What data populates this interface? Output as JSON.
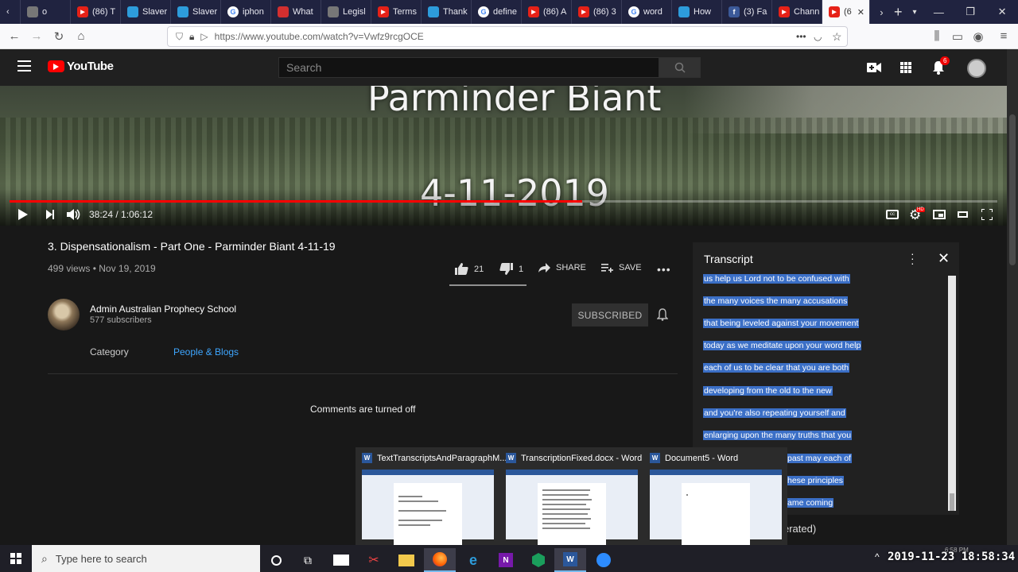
{
  "browser": {
    "tabs": [
      {
        "label": "",
        "icon": "chevron-left-icon",
        "type": "nav"
      },
      {
        "label": "o",
        "icon": "generic-favicon-icon",
        "color": "#777777"
      },
      {
        "label": "(86) T",
        "icon": "youtube-favicon-icon",
        "color": "#e62117"
      },
      {
        "label": "Slaver",
        "icon": "blue-favicon-icon",
        "color": "#2d9cdb"
      },
      {
        "label": "Slaver",
        "icon": "blue-favicon-icon",
        "color": "#2d9cdb"
      },
      {
        "label": "iphon",
        "icon": "google-favicon-icon",
        "color": "#4285f4"
      },
      {
        "label": "What",
        "icon": "red-favicon-icon",
        "color": "#d32f2f"
      },
      {
        "label": "Legisl",
        "icon": "triangle-favicon-icon",
        "color": "#777777"
      },
      {
        "label": "Terms",
        "icon": "youtube-favicon-icon",
        "color": "#e62117"
      },
      {
        "label": "Thank",
        "icon": "blue-favicon-icon",
        "color": "#2d9cdb"
      },
      {
        "label": "define",
        "icon": "google-favicon-icon",
        "color": "#4285f4"
      },
      {
        "label": "(86) A",
        "icon": "youtube-favicon-icon",
        "color": "#e62117"
      },
      {
        "label": "(86) 3",
        "icon": "youtube-favicon-icon",
        "color": "#e62117"
      },
      {
        "label": "word",
        "icon": "google-favicon-icon",
        "color": "#4285f4"
      },
      {
        "label": "How",
        "icon": "edge-favicon-icon",
        "color": "#2d9cdb"
      },
      {
        "label": "(3) Fa",
        "icon": "facebook-favicon-icon",
        "color": "#3b5998"
      },
      {
        "label": "Chann",
        "icon": "youtube-favicon-icon",
        "color": "#e62117"
      },
      {
        "label": "(6",
        "icon": "youtube-favicon-icon",
        "color": "#e62117",
        "active": true
      }
    ],
    "url": "https://www.youtube.com/watch?v=Vwfz9rcgOCE"
  },
  "youtube": {
    "logo_text": "YouTube",
    "search_placeholder": "Search",
    "notification_count": "6"
  },
  "player": {
    "overlay_name": "Parminder Biant",
    "overlay_date": "4-11-2019",
    "current_time": "38:24",
    "duration": "1:06:12",
    "time_display": "38:24 / 1:06:12",
    "progress_fraction": 0.58
  },
  "video": {
    "title": "3. Dispensationalism - Part One - Parminder Biant 4-11-19",
    "views_date": "499 views • Nov 19, 2019",
    "likes": "21",
    "dislikes": "1",
    "share_label": "SHARE",
    "save_label": "SAVE"
  },
  "channel": {
    "name": "Admin Australian Prophecy School",
    "subscribers": "577 subscribers",
    "subscribed_label": "SUBSCRIBED",
    "category_label": "Category",
    "category_value": "People & Blogs"
  },
  "comments": {
    "status": "Comments are turned off"
  },
  "transcript": {
    "title": "Transcript",
    "lines": [
      "us help us Lord not to be confused with",
      "the many voices the many accusations",
      "that being leveled against your movement",
      "today as we meditate upon your word help",
      "each of us to be clear that you are both",
      "developing from the old to the new",
      "and you're also repeating yourself and",
      "enlarging upon the many truths that you",
      "past may each of",
      "hese principles",
      "ame coming"
    ],
    "footer_text": "erated)"
  },
  "taskbar_previews": [
    {
      "title": "TextTranscriptsAndParagraphM..."
    },
    {
      "title": "TranscriptionFixed.docx - Word"
    },
    {
      "title": "Document5 - Word"
    }
  ],
  "taskbar": {
    "search_placeholder": "Type here to search",
    "clock": "2019-11-23  18:58:34",
    "clock_small": "6:58 PM"
  }
}
